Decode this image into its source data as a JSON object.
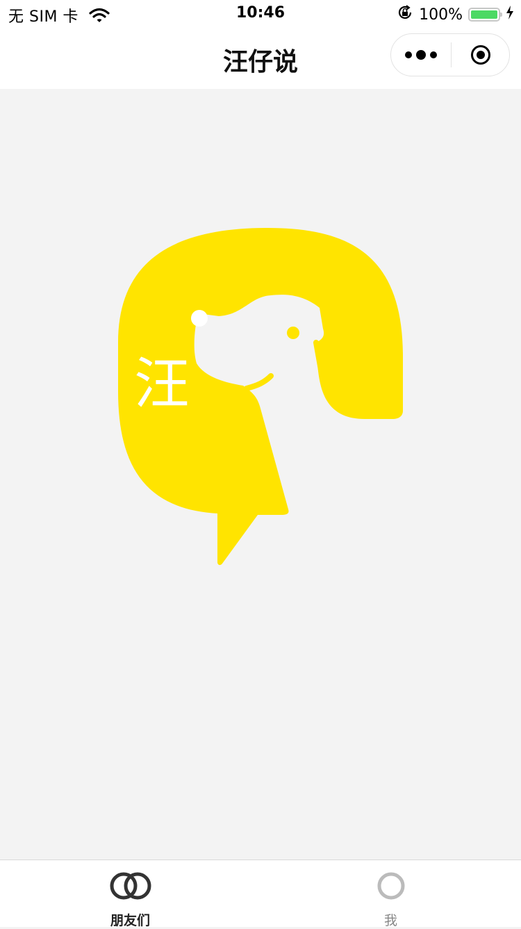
{
  "status_bar": {
    "carrier": "无 SIM 卡",
    "time": "10:46",
    "battery_percent": "100%",
    "battery_level": 1.0,
    "icons": [
      "wifi-icon",
      "orientation-lock-icon",
      "battery-icon",
      "charging-icon"
    ]
  },
  "nav": {
    "title": "汪仔说",
    "capsule_icons": [
      "more-dots-icon",
      "close-target-icon"
    ]
  },
  "logo": {
    "glyph": "汪",
    "color": "#FFE400",
    "icon": "dog-speech-bubble-logo"
  },
  "tabs": [
    {
      "label": "朋友们",
      "icon": "friends-rings-icon",
      "active": true
    },
    {
      "label": "我",
      "icon": "me-ring-icon",
      "active": false
    }
  ],
  "colors": {
    "background": "#F3F3F3",
    "brand_yellow": "#FFE400",
    "tab_active": "#333333",
    "tab_inactive": "#BBBBBB"
  }
}
